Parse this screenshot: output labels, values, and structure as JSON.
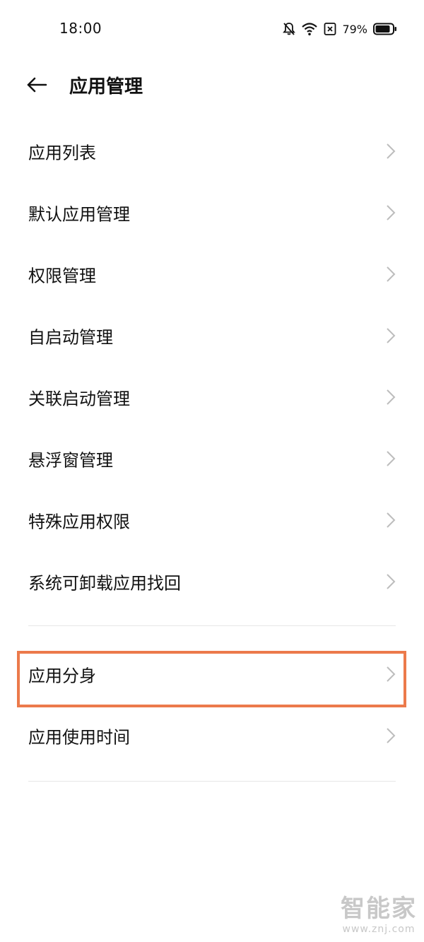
{
  "status_bar": {
    "time": "18:00",
    "battery_percent": "79%",
    "icons": [
      "bell-off-icon",
      "wifi-icon",
      "no-sim-icon",
      "battery-icon"
    ],
    "battery_level": 0.79
  },
  "header": {
    "title": "应用管理",
    "back_icon": "arrow-left-icon"
  },
  "menu": {
    "group1": [
      {
        "label": "应用列表"
      },
      {
        "label": "默认应用管理"
      },
      {
        "label": "权限管理"
      },
      {
        "label": "自启动管理"
      },
      {
        "label": "关联启动管理"
      },
      {
        "label": "悬浮窗管理"
      },
      {
        "label": "特殊应用权限"
      },
      {
        "label": "系统可卸载应用找回"
      }
    ],
    "group2": [
      {
        "label": "应用分身",
        "highlighted": true
      },
      {
        "label": "应用使用时间"
      }
    ]
  },
  "colors": {
    "highlight_border": "#ec7a4b",
    "divider": "#e6e6e6",
    "chevron": "#bdbdbd"
  },
  "watermark": {
    "text": "智能家",
    "url": "www.znj.com"
  }
}
